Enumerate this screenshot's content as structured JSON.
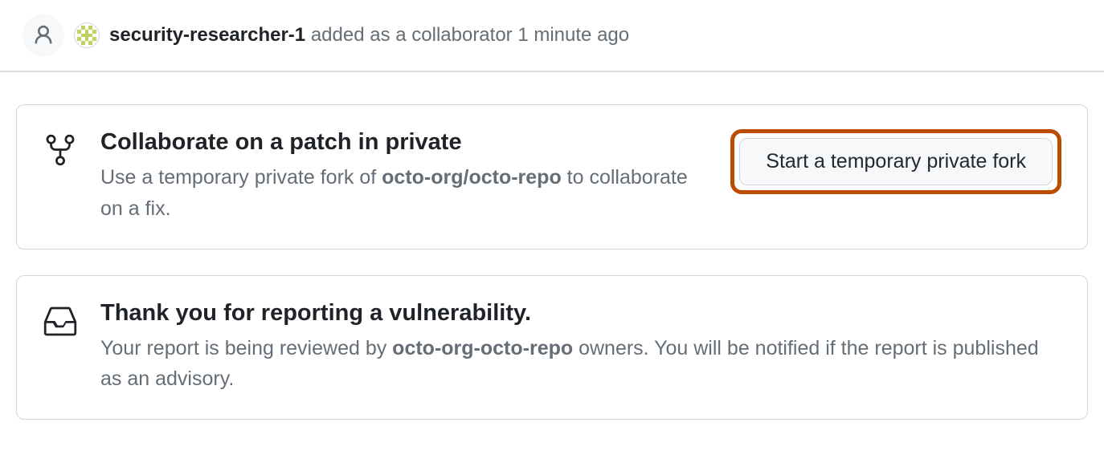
{
  "timeline": {
    "username": "security-researcher-1",
    "action": " added as a collaborator ",
    "timestamp": "1 minute ago"
  },
  "collaborate_card": {
    "title": "Collaborate on a patch in private",
    "desc_prefix": "Use a temporary private fork of ",
    "repo": "octo-org/octo-repo",
    "desc_suffix": " to collaborate on a fix.",
    "button_label": "Start a temporary private fork"
  },
  "thankyou_card": {
    "title": "Thank you for reporting a vulnerability.",
    "desc_prefix": "Your report is being reviewed by ",
    "repo": "octo-org-octo-repo",
    "desc_suffix": " owners. You will be notified if the report is published as an advisory."
  }
}
